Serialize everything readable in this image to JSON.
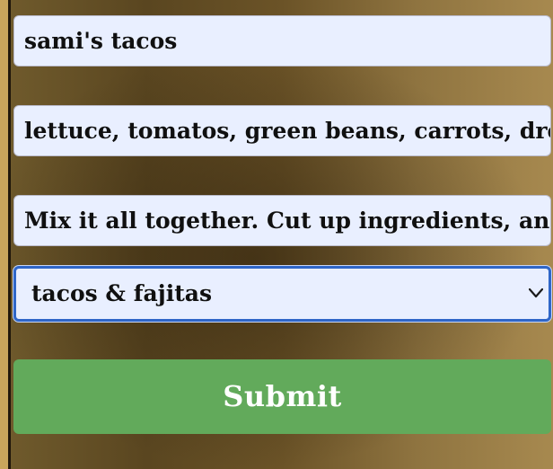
{
  "form": {
    "recipe_name": "sami's tacos",
    "ingredients": "lettuce, tomatos, green beans, carrots, dressing",
    "instructions": "Mix it all together. Cut up ingredients, and eat!",
    "category_selected": "tacos & fajitas",
    "submit_label": "Submit"
  },
  "icons": {
    "select_arrow": "chevron-down-icon"
  },
  "colors": {
    "input_background": "#e9efff",
    "focus_border": "#2f66c8",
    "submit_background": "#62aa5b",
    "submit_text": "#ffffff"
  }
}
